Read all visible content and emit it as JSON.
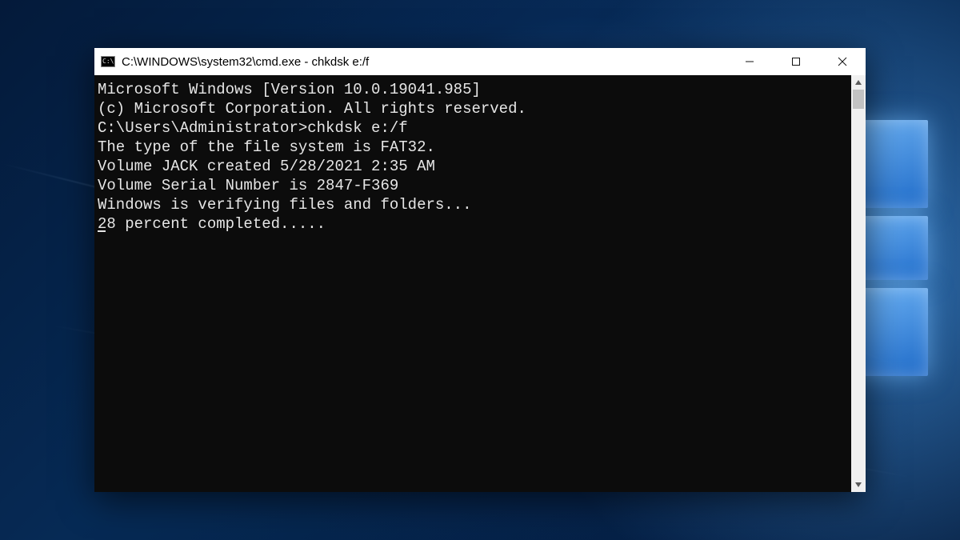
{
  "window": {
    "title": "C:\\WINDOWS\\system32\\cmd.exe - chkdsk  e:/f"
  },
  "terminal": {
    "lines": [
      "Microsoft Windows [Version 10.0.19041.985]",
      "(c) Microsoft Corporation. All rights reserved.",
      "",
      "C:\\Users\\Administrator>chkdsk e:/f",
      "The type of the file system is FAT32.",
      "Volume JACK created 5/28/2021 2:35 AM",
      "Volume Serial Number is 2847-F369",
      "Windows is verifying files and folders...",
      "28 percent completed....."
    ],
    "cursor_on_line_index": 8
  }
}
